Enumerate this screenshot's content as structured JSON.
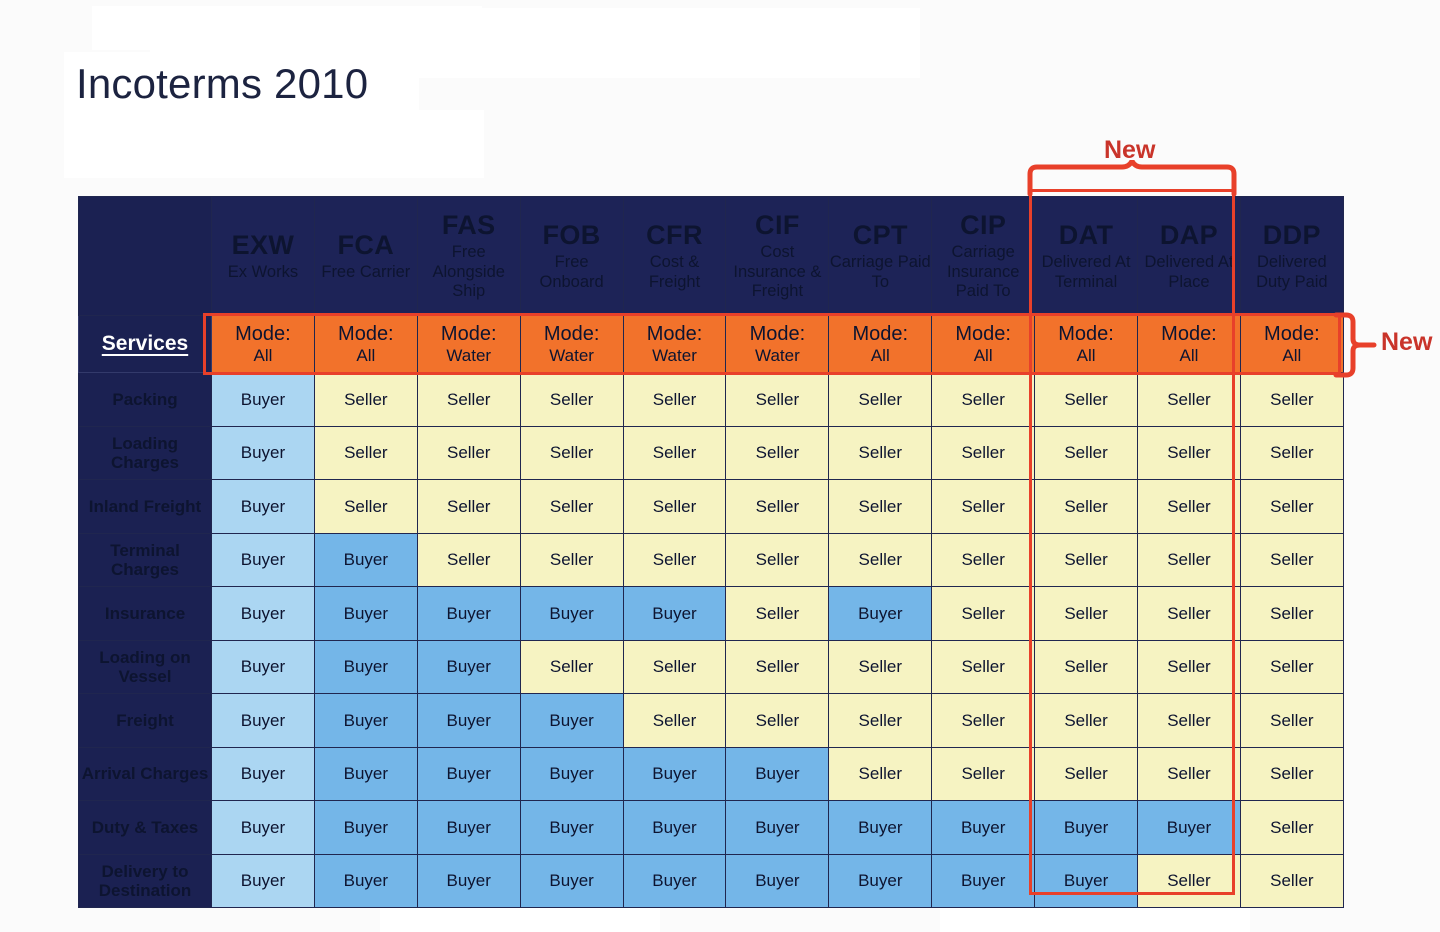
{
  "page": {
    "title": "Incoterms 2010"
  },
  "annotations": {
    "new_top": "New",
    "new_right": "New",
    "accent_red": "#e8402a",
    "label_red": "#c9342a"
  },
  "colors": {
    "header_navy": "#1d2357",
    "mode_orange": "#f2722b",
    "buyer_blue": "#74b6e8",
    "buyer_light_blue": "#abd6f2",
    "seller_yellow": "#f6f3c2"
  },
  "table": {
    "corner_label": "",
    "services_label": "Services",
    "columns": [
      {
        "code": "EXW",
        "full": "Ex Works",
        "mode_label": "Mode:",
        "mode_value": "All"
      },
      {
        "code": "FCA",
        "full": "Free Carrier",
        "mode_label": "Mode:",
        "mode_value": "All"
      },
      {
        "code": "FAS",
        "full": "Free Alongside Ship",
        "mode_label": "Mode:",
        "mode_value": "Water"
      },
      {
        "code": "FOB",
        "full": "Free Onboard",
        "mode_label": "Mode:",
        "mode_value": "Water"
      },
      {
        "code": "CFR",
        "full": "Cost & Freight",
        "mode_label": "Mode:",
        "mode_value": "Water"
      },
      {
        "code": "CIF",
        "full": "Cost Insurance & Freight",
        "mode_label": "Mode:",
        "mode_value": "Water"
      },
      {
        "code": "CPT",
        "full": "Carriage Paid To",
        "mode_label": "Mode:",
        "mode_value": "All"
      },
      {
        "code": "CIP",
        "full": "Carriage Insurance Paid To",
        "mode_label": "Mode:",
        "mode_value": "All"
      },
      {
        "code": "DAT",
        "full": "Delivered At Terminal",
        "mode_label": "Mode:",
        "mode_value": "All"
      },
      {
        "code": "DAP",
        "full": "Delivered At Place",
        "mode_label": "Mode:",
        "mode_value": "All"
      },
      {
        "code": "DDP",
        "full": "Delivered Duty Paid",
        "mode_label": "Mode:",
        "mode_value": "All"
      }
    ],
    "rows": [
      {
        "label": "Packing",
        "cells": [
          "Buyer",
          "Seller",
          "Seller",
          "Seller",
          "Seller",
          "Seller",
          "Seller",
          "Seller",
          "Seller",
          "Seller",
          "Seller"
        ]
      },
      {
        "label": "Loading Charges",
        "cells": [
          "Buyer",
          "Seller",
          "Seller",
          "Seller",
          "Seller",
          "Seller",
          "Seller",
          "Seller",
          "Seller",
          "Seller",
          "Seller"
        ]
      },
      {
        "label": "Inland Freight",
        "cells": [
          "Buyer",
          "Seller",
          "Seller",
          "Seller",
          "Seller",
          "Seller",
          "Seller",
          "Seller",
          "Seller",
          "Seller",
          "Seller"
        ]
      },
      {
        "label": "Terminal Charges",
        "cells": [
          "Buyer",
          "Buyer",
          "Seller",
          "Seller",
          "Seller",
          "Seller",
          "Seller",
          "Seller",
          "Seller",
          "Seller",
          "Seller"
        ]
      },
      {
        "label": "Insurance",
        "cells": [
          "Buyer",
          "Buyer",
          "Buyer",
          "Buyer",
          "Buyer",
          "Seller",
          "Buyer",
          "Seller",
          "Seller",
          "Seller",
          "Seller"
        ]
      },
      {
        "label": "Loading on Vessel",
        "cells": [
          "Buyer",
          "Buyer",
          "Buyer",
          "Seller",
          "Seller",
          "Seller",
          "Seller",
          "Seller",
          "Seller",
          "Seller",
          "Seller"
        ]
      },
      {
        "label": "Freight",
        "cells": [
          "Buyer",
          "Buyer",
          "Buyer",
          "Buyer",
          "Seller",
          "Seller",
          "Seller",
          "Seller",
          "Seller",
          "Seller",
          "Seller"
        ]
      },
      {
        "label": "Arrival Charges",
        "cells": [
          "Buyer",
          "Buyer",
          "Buyer",
          "Buyer",
          "Buyer",
          "Buyer",
          "Seller",
          "Seller",
          "Seller",
          "Seller",
          "Seller"
        ]
      },
      {
        "label": "Duty & Taxes",
        "cells": [
          "Buyer",
          "Buyer",
          "Buyer",
          "Buyer",
          "Buyer",
          "Buyer",
          "Buyer",
          "Buyer",
          "Buyer",
          "Buyer",
          "Seller"
        ]
      },
      {
        "label": "Delivery to Destination",
        "cells": [
          "Buyer",
          "Buyer",
          "Buyer",
          "Buyer",
          "Buyer",
          "Buyer",
          "Buyer",
          "Buyer",
          "Buyer",
          "Seller",
          "Seller"
        ]
      }
    ]
  }
}
